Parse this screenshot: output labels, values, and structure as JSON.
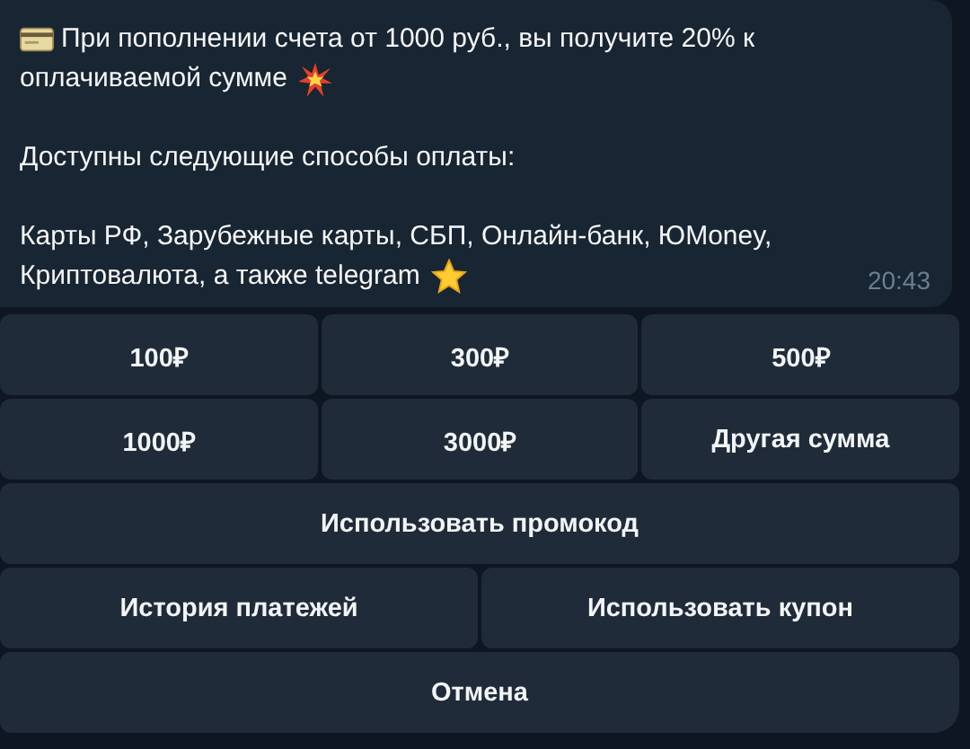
{
  "message": {
    "paragraphs": [
      {
        "lines": [
          "При пополнении счета от 1000 руб., вы получите 20% к",
          "оплачиваемой сумме"
        ]
      },
      {
        "lines": [
          "Доступны следующие способы оплаты:"
        ]
      },
      {
        "lines": [
          "Карты РФ, Зарубежные карты, СБП, Онлайн-банк, ЮMoney,",
          "Криптовалюта, а также telegram"
        ]
      }
    ],
    "time": "20:43"
  },
  "keyboard": {
    "rows": [
      {
        "buttons": [
          "100₽",
          "300₽",
          "500₽"
        ]
      },
      {
        "buttons": [
          "1000₽",
          "3000₽",
          "Другая сумма"
        ]
      },
      {
        "buttons": [
          "Использовать промокод"
        ]
      },
      {
        "buttons": [
          "История платежей",
          "Использовать купон"
        ]
      },
      {
        "buttons": [
          "Отмена"
        ]
      }
    ]
  }
}
